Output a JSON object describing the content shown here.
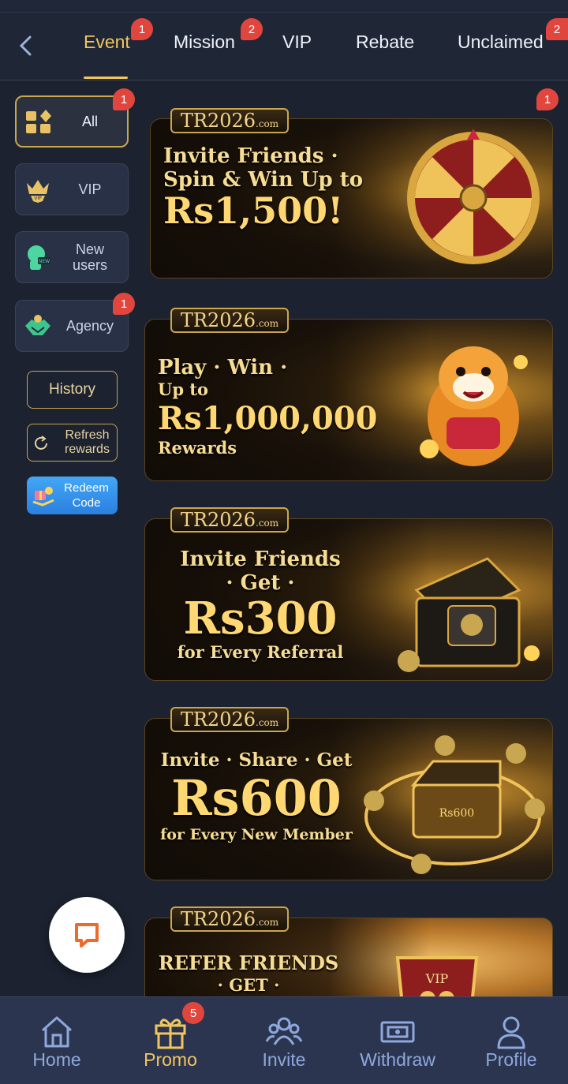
{
  "header": {
    "tabs": [
      {
        "label": "Event",
        "badge": "1",
        "active": true
      },
      {
        "label": "Mission",
        "badge": "2"
      },
      {
        "label": "VIP"
      },
      {
        "label": "Rebate"
      },
      {
        "label": "Unclaimed",
        "badge": "2"
      }
    ]
  },
  "sidebar": {
    "items": [
      {
        "label": "All",
        "badge": "1",
        "icon": "grid-icon",
        "active": true
      },
      {
        "label": "VIP",
        "icon": "crown-icon"
      },
      {
        "label": "New\nusers",
        "icon": "new-user-icon"
      },
      {
        "label": "Agency",
        "badge": "1",
        "icon": "handshake-icon"
      }
    ],
    "history_label": "History",
    "refresh_label": "Refresh\nrewards",
    "redeem_label": "Redeem\nCode"
  },
  "banners": [
    {
      "logo": "TR2026",
      "logo_suffix": ".com",
      "line1": "Invite Friends ·",
      "line2": "Spin & Win Up to",
      "amount": "Rs1,500!",
      "badge": "1"
    },
    {
      "logo": "TR2026",
      "logo_suffix": ".com",
      "line1": "Play · Win ·",
      "line2": "Up to",
      "amount": "Rs1,000,000",
      "line3": "Rewards"
    },
    {
      "logo": "TR2026",
      "logo_suffix": ".com",
      "line1": "Invite Friends",
      "line2": "· Get ·",
      "amount": "Rs300",
      "line3": "for Every Referral"
    },
    {
      "logo": "TR2026",
      "logo_suffix": ".com",
      "line1": "Invite · Share · Get",
      "amount": "Rs600",
      "line3": "for Every New Member",
      "chest_label": "Rs600"
    },
    {
      "logo": "TR2026",
      "logo_suffix": ".com",
      "line1": "REFER FRIENDS",
      "line2": "· GET ·",
      "emblem": "VIP"
    }
  ],
  "bottom_nav": [
    {
      "label": "Home",
      "icon": "home-icon"
    },
    {
      "label": "Promo",
      "icon": "gift-icon",
      "badge": "5",
      "active": true
    },
    {
      "label": "Invite",
      "icon": "invite-icon"
    },
    {
      "label": "Withdraw",
      "icon": "withdraw-icon"
    },
    {
      "label": "Profile",
      "icon": "profile-icon"
    }
  ],
  "colors": {
    "accent": "#f2c65f",
    "badge": "#e0463d",
    "background": "#1c2230",
    "nav": "#2c3550"
  }
}
